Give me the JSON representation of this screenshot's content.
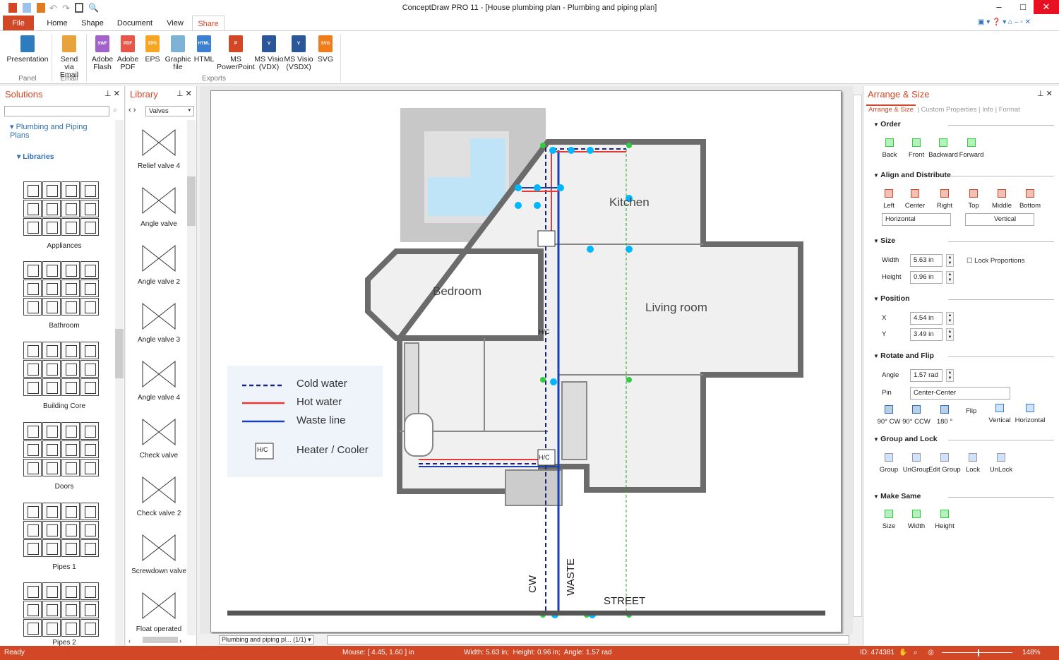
{
  "window": {
    "title": "ConceptDraw PRO 11 - [House plumbing plan - Plumbing and piping plan]"
  },
  "tabs": [
    "File",
    "Home",
    "Shape",
    "Document",
    "View",
    "Share"
  ],
  "ribbon": {
    "buttons": [
      {
        "label": "Presentation",
        "icon": "presentation-icon",
        "color": "#2e7bbf"
      },
      {
        "label": "Send via Email",
        "icon": "email-icon",
        "color": "#e8a33d"
      },
      {
        "label": "Adobe Flash",
        "icon": "swf-file-icon",
        "color": "#a262c9",
        "tag": "SWF"
      },
      {
        "label": "Adobe PDF",
        "icon": "pdf-file-icon",
        "color": "#e8564a",
        "tag": "PDF"
      },
      {
        "label": "EPS",
        "icon": "eps-file-icon",
        "color": "#f5a623",
        "tag": "EPS"
      },
      {
        "label": "Graphic file",
        "icon": "image-file-icon",
        "color": "#7fb3d5",
        "tag": ""
      },
      {
        "label": "HTML",
        "icon": "html-file-icon",
        "color": "#3d7fd1",
        "tag": "HTML"
      },
      {
        "label": "MS PowerPoint",
        "icon": "powerpoint-icon",
        "color": "#d24726",
        "tag": "P"
      },
      {
        "label": "MS Visio (VDX)",
        "icon": "visio-vdx-icon",
        "color": "#2b579a",
        "tag": "V"
      },
      {
        "label": "MS Visio (VSDX)",
        "icon": "visio-vsdx-icon",
        "color": "#2b579a",
        "tag": "V"
      },
      {
        "label": "SVG",
        "icon": "svg-file-icon",
        "color": "#f07d1a",
        "tag": "SVG"
      }
    ],
    "groups": [
      "Panel",
      "Email",
      "Exports"
    ]
  },
  "solutions": {
    "title": "Solutions",
    "tree_item": "Plumbing and Piping Plans",
    "libraries_label": "Libraries",
    "groups": [
      "Appliances",
      "Bathroom",
      "Building Core",
      "Doors",
      "Pipes 1",
      "Pipes 2"
    ]
  },
  "library": {
    "title": "Library",
    "selected": "Valves",
    "items": [
      "Relief valve 4",
      "Angle valve",
      "Angle valve 2",
      "Angle valve 3",
      "Angle valve 4",
      "Check valve",
      "Check valve 2",
      "Screwdown valve",
      "Float operated"
    ]
  },
  "drawing": {
    "rooms": [
      "Kitchen",
      "Bedroom",
      "Living room"
    ],
    "labels": {
      "cw": "CW",
      "waste": "WASTE",
      "street": "STREET",
      "hc": "H/C"
    },
    "legend": [
      {
        "label": "Cold water",
        "color": "#1a237e",
        "style": "dashed"
      },
      {
        "label": "Hot water",
        "color": "#e53935",
        "style": "solid"
      },
      {
        "label": "Waste line",
        "color": "#1e3fae",
        "style": "solid"
      },
      {
        "label": "Heater / Cooler",
        "style": "hc-symbol"
      }
    ],
    "page_tab": "Plumbing and piping pl... (1/1)"
  },
  "arrange": {
    "title": "Arrange & Size",
    "tabs": [
      "Arrange & Size",
      "Custom Properties",
      "Info",
      "Format"
    ],
    "order": {
      "title": "Order",
      "buttons": [
        "Back",
        "Front",
        "Backward",
        "Forward"
      ]
    },
    "align": {
      "title": "Align and Distribute",
      "buttons": [
        "Left",
        "Center",
        "Right",
        "Top",
        "Middle",
        "Bottom"
      ],
      "horizontal": "Horizontal",
      "vertical": "Vertical"
    },
    "size": {
      "title": "Size",
      "width_label": "Width",
      "width": "5.63 in",
      "height_label": "Height",
      "height": "0.96 in",
      "lock": "Lock Proportions"
    },
    "position": {
      "title": "Position",
      "x_label": "X",
      "x": "4.54 in",
      "y_label": "Y",
      "y": "3.49 in"
    },
    "rotate": {
      "title": "Rotate and Flip",
      "angle_label": "Angle",
      "angle": "1.57 rad",
      "pin_label": "Pin",
      "pin": "Center-Center",
      "buttons": [
        "90° CW",
        "90° CCW",
        "180 °"
      ],
      "flip": "Flip",
      "flip_buttons": [
        "Vertical",
        "Horizontal"
      ]
    },
    "group": {
      "title": "Group and Lock",
      "buttons": [
        "Group",
        "UnGroup",
        "Edit Group",
        "Lock",
        "UnLock"
      ]
    },
    "same": {
      "title": "Make Same",
      "buttons": [
        "Size",
        "Width",
        "Height"
      ]
    }
  },
  "status": {
    "ready": "Ready",
    "mouse": "Mouse: [ 4.45, 1.60 ] in",
    "dims": "Width: 5.63 in;  Height: 0.96 in;  Angle: 1.57 rad",
    "id": "ID: 474381",
    "zoom": "148%"
  },
  "colors": {
    "accent": "#d24726"
  }
}
